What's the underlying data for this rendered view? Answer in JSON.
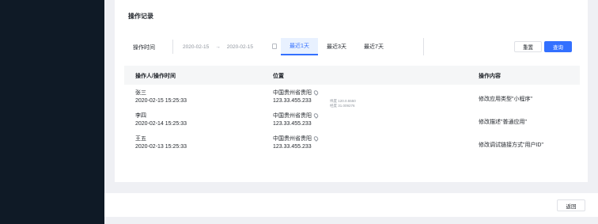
{
  "card": {
    "title": "操作记录"
  },
  "filter": {
    "label": "操作时间",
    "start_date": "2020-02-15",
    "separator": "→",
    "end_date": "2020-02-15",
    "quick_tabs": [
      "最近1天",
      "最近3天",
      "最近7天"
    ],
    "active_tab": 0,
    "reset_label": "重置",
    "query_label": "查询"
  },
  "table": {
    "headers": [
      "操作人/操作时间",
      "位置",
      "操作内容"
    ],
    "rows": [
      {
        "operator": "张三",
        "time": "2020-02-15 15:25:33",
        "location": "中国贵州省贵阳",
        "ip": "123.33.455.233",
        "action": "修改应用类型\"小程序\""
      },
      {
        "operator": "李四",
        "time": "2020-02-14 15:25:33",
        "location": "中国贵州省贵阳",
        "ip": "123.33.455.233",
        "action": "修改描述\"普通应用\""
      },
      {
        "operator": "王五",
        "time": "2020-02-13 15:25:33",
        "location": "中国贵州省贵阳",
        "ip": "123.33.455.233",
        "action": "修改调试链接方式\"用户ID\""
      }
    ],
    "coords": [
      "纬度 120.0.5550",
      "经度 31.009276"
    ]
  },
  "footer": {
    "back_label": "返回"
  }
}
